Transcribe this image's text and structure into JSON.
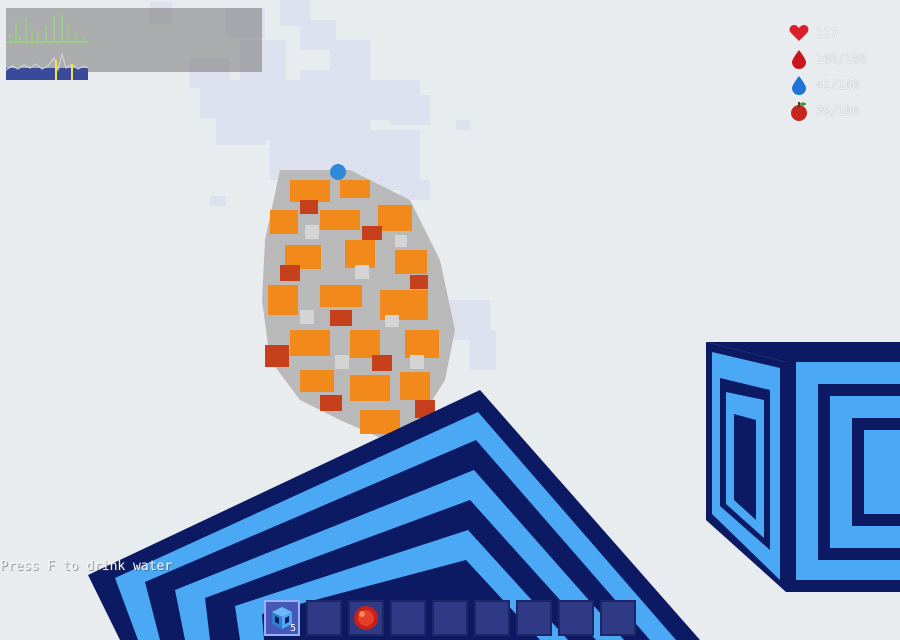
{
  "stats": {
    "health": "117",
    "blood": "100/100",
    "water": "41/100",
    "food": "39/100"
  },
  "hint": "Press F to drink water",
  "hotbar": {
    "slots": [
      {
        "item": "blue-block",
        "count": "5"
      },
      {
        "item": "empty",
        "count": ""
      },
      {
        "item": "red-orb",
        "count": ""
      },
      {
        "item": "empty",
        "count": ""
      },
      {
        "item": "empty",
        "count": ""
      },
      {
        "item": "empty",
        "count": ""
      },
      {
        "item": "empty",
        "count": ""
      },
      {
        "item": "empty",
        "count": ""
      },
      {
        "item": "empty",
        "count": ""
      }
    ],
    "selected_index": 0
  },
  "colors": {
    "sky": "#e9ecef",
    "block_light": "#4aa8f5",
    "block_dark": "#0c1a63",
    "ore_orange": "#f28a1b",
    "ore_red": "#c6401c",
    "stone": "#b7b7b7",
    "health": "#d8202a",
    "water": "#1f74d6",
    "food": "#c7261f"
  }
}
